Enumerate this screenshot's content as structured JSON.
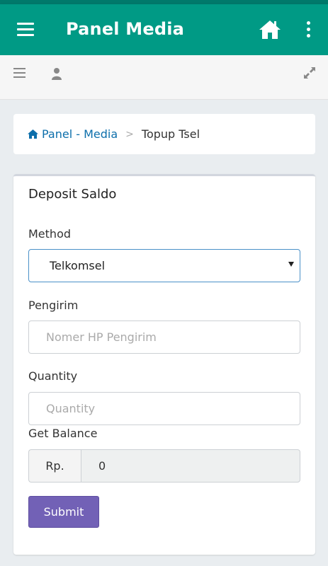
{
  "appbar": {
    "title": "Panel Media",
    "color": "#009a85"
  },
  "toolbar": {
    "icons": [
      "menu-icon",
      "user-icon",
      "expand-icon"
    ]
  },
  "breadcrumb": {
    "home_label": "Panel - Media",
    "separator": ">",
    "current": "Topup Tsel"
  },
  "card": {
    "title": "Deposit Saldo",
    "method": {
      "label": "Method",
      "selected": "Telkomsel"
    },
    "pengirim": {
      "label": "Pengirim",
      "placeholder": "Nomer HP Pengirim"
    },
    "quantity": {
      "label": "Quantity",
      "placeholder": "Quantity"
    },
    "balance": {
      "label": "Get Balance",
      "prefix": "Rp.",
      "value": "0"
    },
    "submit_label": "Submit",
    "submit_color": "#7261b6"
  }
}
